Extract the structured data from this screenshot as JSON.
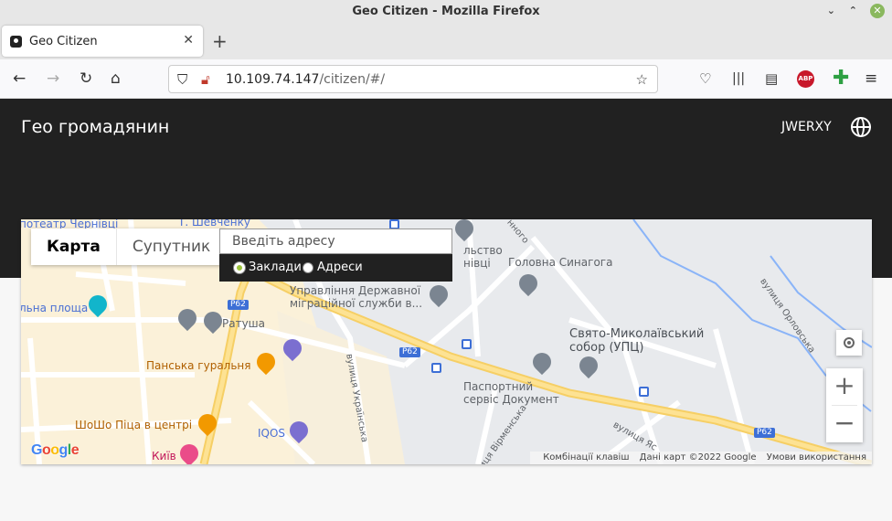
{
  "window": {
    "title": "Geo Citizen - Mozilla Firefox"
  },
  "browser": {
    "tab_title": "Geo Citizen",
    "url_host": "10.109.74.147",
    "url_path": "/citizen/#/"
  },
  "header": {
    "brand": "Гео громадянин",
    "user": "JWERXY"
  },
  "map": {
    "type_tabs": [
      "Карта",
      "Супутник"
    ],
    "search_placeholder": "Введіть адресу",
    "filters": [
      "Заклади",
      "Адреси"
    ],
    "attribution": [
      "Комбінації клавіш",
      "Дані карт ©2022 Google",
      "Умови використання"
    ],
    "google": "Google",
    "labels": {
      "theatre": "потеатр Чернівці",
      "shevchenka": "Т. Шевченку",
      "ploshcha": "льна площа",
      "ratusha": "Ратуша",
      "gouralnia": "Панська гуральня",
      "shosho": "ШоШо Піца в центрі",
      "kyiv": "Київ",
      "iqos": "IQOS",
      "migration": "Управління Державної міграційної служби в...",
      "chernivtsi": "льство нівці",
      "synagogue": "Головна Синагога",
      "cathedral": "Свято-Миколаївський собор (УПЦ)",
      "passport": "Паспортний сервіс Документ",
      "ukrainska": "вулиця Українська",
      "virmenska": "вулиця Вірменська",
      "orlovska": "вулиця Орловська",
      "yasna": "вулиця Яс",
      "nnoho": "нного",
      "route": "P62"
    }
  },
  "colors": {
    "header_bg": "#212121",
    "accent_radio": "#9bc23c"
  }
}
